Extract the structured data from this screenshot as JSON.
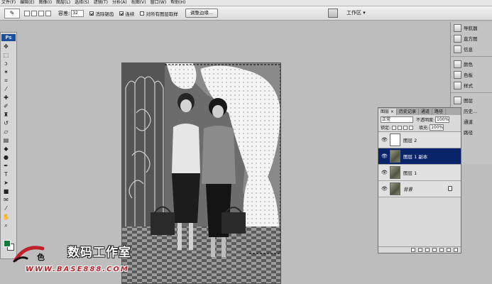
{
  "menubar": {
    "items": [
      "文件(F)",
      "编辑(E)",
      "图像(I)",
      "图层(L)",
      "选择(S)",
      "滤镜(T)",
      "分析(A)",
      "视图(V)",
      "窗口(W)",
      "帮助(H)"
    ]
  },
  "options": {
    "tolerance_label": "容差:",
    "tolerance_value": "32",
    "anti_alias_label": "消除锯齿",
    "contiguous_label": "连续",
    "sample_all_label": "对所有图层取样",
    "refine_edge_label": "调整边缘...",
    "workspace_label": "工作区 ▾"
  },
  "toolbar": {
    "logo": "Ps"
  },
  "dock": {
    "group1": [
      "导航器",
      "直方图",
      "信息"
    ],
    "group2": [
      "颜色",
      "色板",
      "样式"
    ],
    "group3": [
      "图层",
      "历史...",
      "通道",
      "路径"
    ]
  },
  "layers_panel": {
    "tabs": [
      "图层 ×",
      "历史记录",
      "通道",
      "路径"
    ],
    "blend_mode": "正常",
    "opacity_label": "不透明度:",
    "opacity_value": "100%",
    "lock_label": "锁定:",
    "fill_label": "填充:",
    "fill_value": "100%",
    "layers": [
      {
        "name": "图层 2",
        "selected": false,
        "thumb": "blank"
      },
      {
        "name": "图层 1 副本",
        "selected": true,
        "thumb": "photo"
      },
      {
        "name": "图层 1",
        "selected": false,
        "thumb": "photo"
      },
      {
        "name": "背景",
        "selected": false,
        "thumb": "photo",
        "italic": true,
        "locked": true
      }
    ]
  },
  "watermark": {
    "title": "数码工作室",
    "url": "WWW.BASE888.COM",
    "logo_text": "色"
  },
  "colors": {
    "foreground": "#0b7e3c",
    "selected_layer": "#0a246a"
  }
}
